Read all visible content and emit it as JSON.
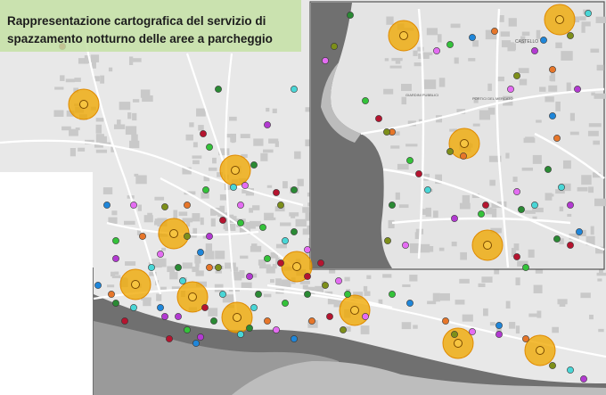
{
  "title": {
    "line1": "Rappresentazione cartografica del servizio di",
    "line2": "spazzamento notturno delle aree a parcheggio"
  },
  "map_labels": {
    "castello": "CASTELLO",
    "label_a": "PORTICI DEL MERCATO",
    "label_b": "GIARDINI PUBBLICI"
  },
  "colors": {
    "water": "#6f6f6f",
    "land": "#ececec",
    "urban": "#cfcfcf",
    "road": "#ffffff",
    "zone": "#f0a800"
  }
}
